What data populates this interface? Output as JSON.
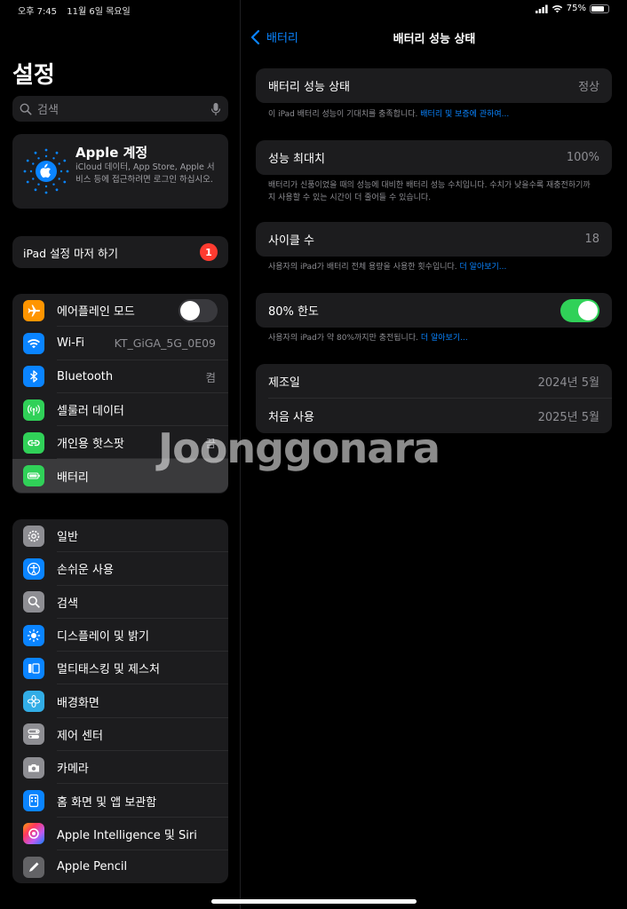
{
  "status": {
    "time": "오후 7:45",
    "date": "11월 6일 목요일",
    "battery": "75%"
  },
  "sidebar": {
    "title": "설정",
    "search_placeholder": "검색",
    "account": {
      "title": "Apple 계정",
      "subtitle": "iCloud 데이터, App Store, Apple 서비스 등에 접근하려면 로그인 하십시오."
    },
    "setup": {
      "label": "iPad 설정 마저 하기",
      "badge": "1"
    },
    "group1": [
      {
        "label": "에어플레인 모드",
        "icon": "airplane-icon",
        "color": "#ff9500",
        "toggle": false
      },
      {
        "label": "Wi-Fi",
        "icon": "wifi-icon",
        "color": "#0a84ff",
        "value": "KT_GiGA_5G_0E09"
      },
      {
        "label": "Bluetooth",
        "icon": "bluetooth-icon",
        "color": "#0a84ff",
        "value": "켬"
      },
      {
        "label": "셀룰러 데이터",
        "icon": "cellular-icon",
        "color": "#30d158"
      },
      {
        "label": "개인용 핫스팟",
        "icon": "hotspot-icon",
        "color": "#30d158",
        "value": "끔"
      },
      {
        "label": "배터리",
        "icon": "battery-icon",
        "color": "#30d158",
        "selected": true
      }
    ],
    "group2": [
      {
        "label": "일반",
        "icon": "gear-icon",
        "color": "#8e8e93"
      },
      {
        "label": "손쉬운 사용",
        "icon": "accessibility-icon",
        "color": "#0a84ff"
      },
      {
        "label": "검색",
        "icon": "search-icon",
        "color": "#8e8e93"
      },
      {
        "label": "디스플레이 및 밝기",
        "icon": "brightness-icon",
        "color": "#0a84ff"
      },
      {
        "label": "멀티태스킹 및 제스처",
        "icon": "multitasking-icon",
        "color": "#0a84ff"
      },
      {
        "label": "배경화면",
        "icon": "wallpaper-icon",
        "color": "#32ade6"
      },
      {
        "label": "제어 센터",
        "icon": "control-center-icon",
        "color": "#8e8e93"
      },
      {
        "label": "카메라",
        "icon": "camera-icon",
        "color": "#8e8e93"
      },
      {
        "label": "홈 화면 및 앱 보관함",
        "icon": "home-screen-icon",
        "color": "#0a84ff"
      },
      {
        "label": "Apple Intelligence 및 Siri",
        "icon": "siri-icon",
        "color": "#bf5af2"
      },
      {
        "label": "Apple Pencil",
        "icon": "pencil-icon",
        "color": "#636366"
      }
    ]
  },
  "detail": {
    "back_label": "배터리",
    "title": "배터리 성능 상태",
    "health": {
      "label": "배터리 성능 상태",
      "value": "정상",
      "footer": "이 iPad 배터리 성능이 기대치를 충족합니다. ",
      "footer_link": "배터리 및 보증에 관하여..."
    },
    "capacity": {
      "label": "성능 최대치",
      "value": "100%",
      "footer": "배터리가 신품이었을 때의 성능에 대비한 배터리 성능 수치입니다. 수치가 낮을수록 재충전하기까지 사용할 수 있는 시간이 더 줄어들 수 있습니다."
    },
    "cycle": {
      "label": "사이클 수",
      "value": "18",
      "footer": "사용자의 iPad가 배터리 전체 용량을 사용한 횟수입니다. ",
      "footer_link": "더 알아보기..."
    },
    "limit": {
      "label": "80% 한도",
      "toggle": true,
      "footer": "사용자의 iPad가 약 80%까지만 충전됩니다. ",
      "footer_link": "더 알아보기..."
    },
    "manufacture": {
      "label": "제조일",
      "value": "2024년 5월"
    },
    "first_use": {
      "label": "처음 사용",
      "value": "2025년 5월"
    }
  },
  "watermark": "Joonggonara"
}
